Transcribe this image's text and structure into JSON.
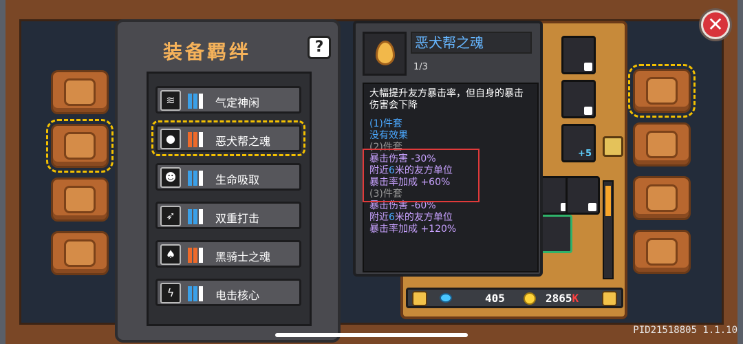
{
  "panel": {
    "title": "装备羁绊",
    "help_label": "?"
  },
  "bonds": [
    {
      "name": "气定神闲",
      "icon": "wind-icon",
      "color": "blue",
      "selected": false
    },
    {
      "name": "恶犬帮之魂",
      "icon": "flame-soul-icon",
      "color": "orange",
      "selected": true
    },
    {
      "name": "生命吸取",
      "icon": "skull-icon",
      "color": "blue",
      "selected": false
    },
    {
      "name": "双重打击",
      "icon": "bow-icon",
      "color": "blue",
      "selected": false
    },
    {
      "name": "黑骑士之魂",
      "icon": "dark-flame-icon",
      "color": "orange",
      "selected": false
    },
    {
      "name": "电击核心",
      "icon": "lightning-icon",
      "color": "blue",
      "selected": false
    }
  ],
  "tooltip": {
    "name": "恶犬帮之魂",
    "count": "1/3",
    "description": "大幅提升友方暴击率，但自身的暴击伤害会下降",
    "tier1_title": "(1)件套",
    "tier1_effect": "没有效果",
    "tier2_title": "(2)件套",
    "tier2_line1": "暴击伤害 -30%",
    "tier2_line2_pre": "附近",
    "tier2_line2_num": "6",
    "tier2_line2_post": "米的友方单位",
    "tier2_line3": "暴击率加成 +60%",
    "tier3_title": "(3)件套",
    "tier3_line1": "暴击伤害 -60%",
    "tier3_line2_pre": "附近",
    "tier3_line2_num": "6",
    "tier3_line2_post": "米的友方单位",
    "tier3_line3": "暴击率加成 +120%"
  },
  "currency": {
    "gems": "405",
    "coins": "2865",
    "coins_suffix": "K"
  },
  "inventory": {
    "slot_level": "+5"
  },
  "footer": {
    "pid": "PID21518805 1.1.10"
  },
  "colors": {
    "accent_gold": "#f3c000",
    "tooltip_blue": "#4aa8ff",
    "tooltip_purple": "#c8a2ff",
    "highlight_red": "#e03a3a"
  }
}
